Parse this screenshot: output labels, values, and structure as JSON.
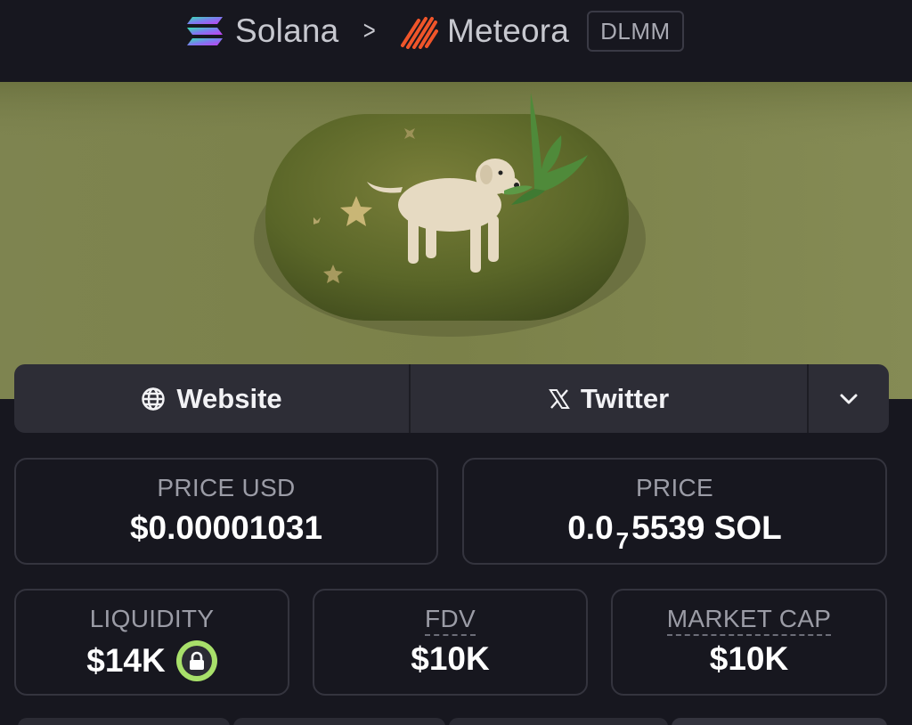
{
  "breadcrumb": {
    "chain": "Solana",
    "separator": ">",
    "dex": "Meteora",
    "badge": "DLMM"
  },
  "links": {
    "website": "Website",
    "twitter": "Twitter"
  },
  "stats": {
    "price_usd": {
      "label": "PRICE USD",
      "value": "$0.00001031"
    },
    "price": {
      "label": "PRICE",
      "value_prefix": "0.0",
      "value_subscript": "7",
      "value_suffix": "5539 SOL"
    },
    "liquidity": {
      "label": "LIQUIDITY",
      "value": "$14K"
    },
    "fdv": {
      "label": "FDV",
      "value": "$10K"
    },
    "market_cap": {
      "label": "MARKET CAP",
      "value": "$10K"
    }
  },
  "icons": {
    "chain": "solana-icon",
    "dex": "meteora-icon",
    "website": "globe-icon",
    "twitter": "x-icon",
    "more": "chevron-down-icon",
    "lock": "lock-icon"
  },
  "colors": {
    "background": "#17171f",
    "card_border": "#34343e",
    "link_bar": "#2d2d36",
    "lock_ring": "#a8e06a",
    "meteora_orange": "#f0552a"
  }
}
